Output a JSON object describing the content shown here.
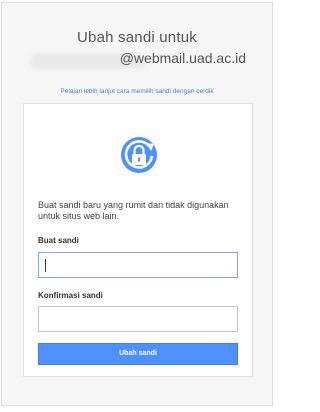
{
  "header": {
    "title": "Ubah sandi untuk",
    "email": "@webmail.uad.ac.id"
  },
  "learn_link": "Pelajari lebih lanjut cara memilih sandi dengan cerdik",
  "card": {
    "icon": "lock-refresh-icon",
    "description": "Buat sandi baru yang rumit dan tidak digunakan untuk situs web lain.",
    "new_password_label": "Buat sandi",
    "new_password_value": "",
    "confirm_password_label": "Konfirmasi sandi",
    "confirm_password_value": "",
    "submit_label": "Ubah sandi"
  },
  "colors": {
    "accent": "#4d90fe",
    "link": "#4a7fd0"
  }
}
